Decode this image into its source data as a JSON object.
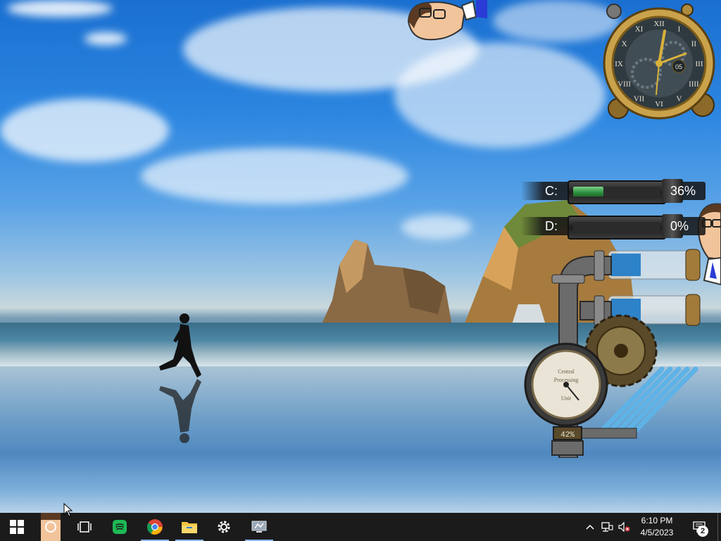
{
  "gadgets": {
    "clock": {
      "numerals": [
        "XII",
        "I",
        "II",
        "III",
        "IIII",
        "V",
        "VI",
        "VII",
        "VIII",
        "IX",
        "X",
        "XI"
      ],
      "seconds": "05"
    },
    "drives": [
      {
        "letter": "C:",
        "percent_text": "36%",
        "usage": 0.36
      },
      {
        "letter": "D:",
        "percent_text": "0%",
        "usage": 0.0
      }
    ],
    "cpu_gauge": {
      "label_line1": "Central",
      "label_line2": "Processing",
      "label_line3": "Unit",
      "percent_text": "42%"
    }
  },
  "taskbar": {
    "pinned": [
      {
        "name": "start",
        "icon": "windows-logo-icon"
      },
      {
        "name": "cortana",
        "icon": "cortana-circle-icon"
      },
      {
        "name": "task-view",
        "icon": "task-view-icon"
      },
      {
        "name": "spotify",
        "icon": "spotify-icon"
      },
      {
        "name": "chrome",
        "icon": "chrome-icon"
      },
      {
        "name": "file-explorer",
        "icon": "folder-icon"
      },
      {
        "name": "settings",
        "icon": "gear-icon"
      },
      {
        "name": "screen-capture",
        "icon": "monitor-icon"
      }
    ],
    "tray": {
      "time": "6:10 PM",
      "date": "4/5/2023",
      "notification_count": "2"
    }
  },
  "colors": {
    "taskbar": "#1b1b1b",
    "active_indicator": "#8ab4e8",
    "spotify": "#1db954",
    "folder": "#f4c542",
    "meter_fill": "#2c8f3d"
  }
}
